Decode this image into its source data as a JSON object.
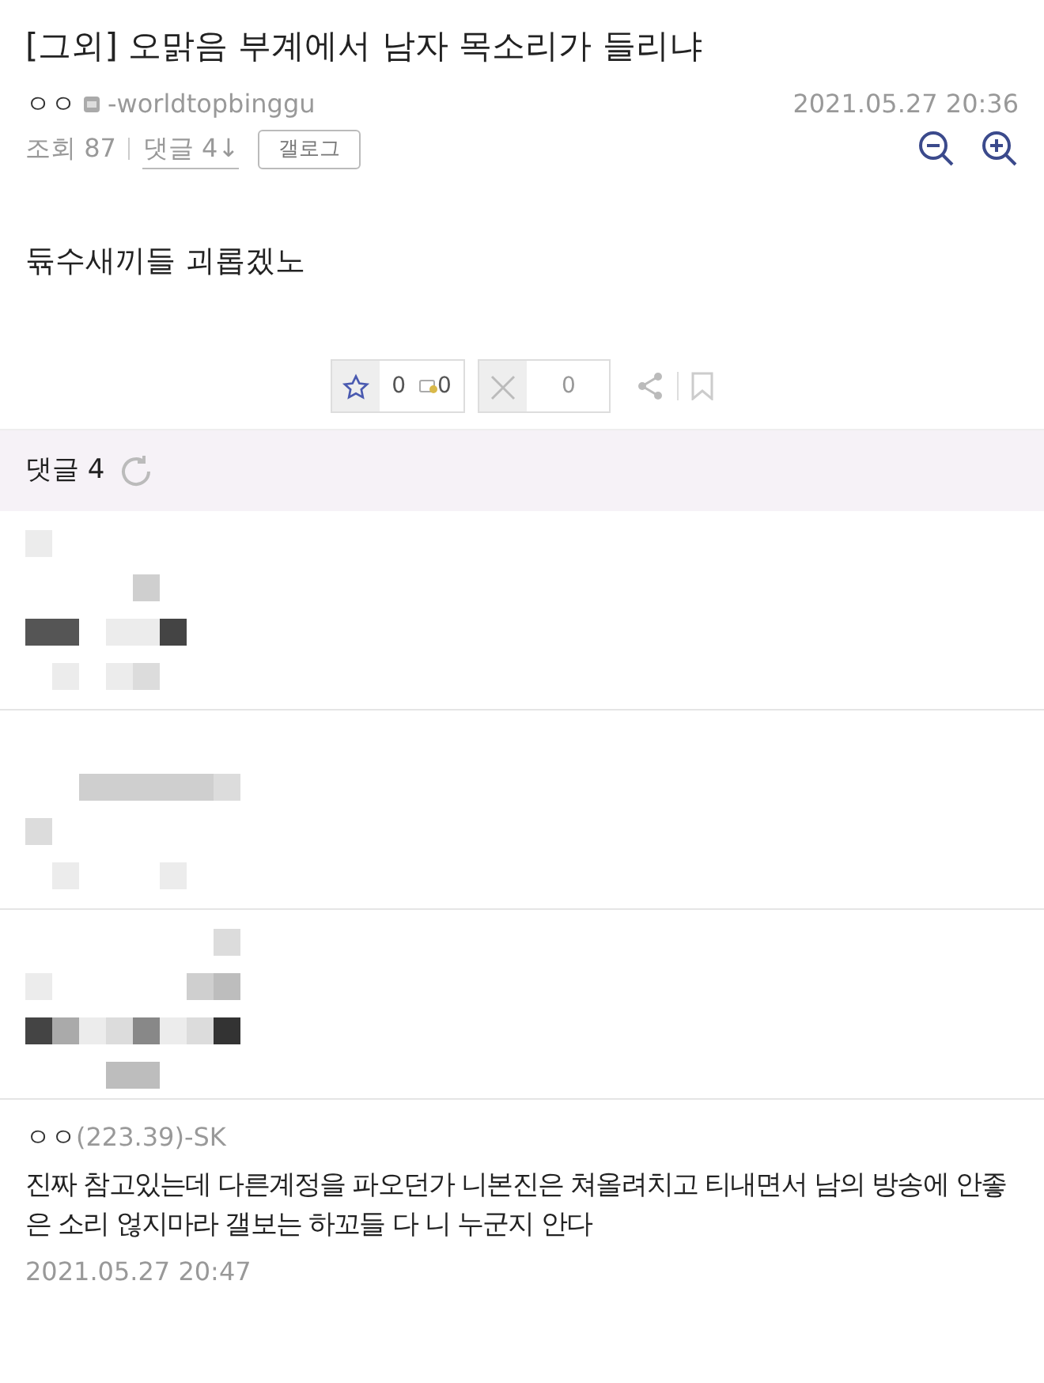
{
  "post": {
    "title": "[그외] 오맑음 부계에서 남자 목소리가 들리냐",
    "author": "ㅇㅇ",
    "author_id": "-worldtopbinggu",
    "date": "2021.05.27 20:36",
    "views": "조회 87",
    "comment_link": "댓글 4↓",
    "gallog_button": "갤로그",
    "body": "듂수새끼들 괴롭겠노"
  },
  "actions": {
    "recommend_count": "0",
    "fix_count": "0",
    "downvote_count": "0"
  },
  "comments_header": {
    "label": "댓글 4"
  },
  "hidden_comments": [
    {
      "kind": "pixelated"
    },
    {
      "kind": "pixelated"
    },
    {
      "kind": "pixelated"
    }
  ],
  "comment": {
    "author": "ㅇㅇ",
    "ip": "(223.39)-SK",
    "text": "진짜 참고있는데 다른계정을 파오던가 니본진은 쳐올려치고 티내면서 남의 방송에 안좋은 소리 얺지마라 갤보는 하꼬들 다 니 누군지 안다",
    "date": "2021.05.27 20:47"
  }
}
